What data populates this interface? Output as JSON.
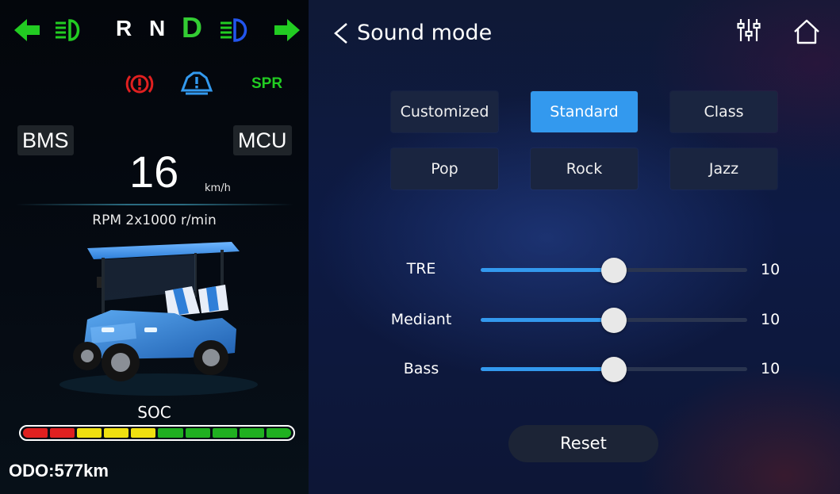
{
  "dash": {
    "gears": [
      "R",
      "N",
      "D"
    ],
    "active_gear": "D",
    "spr_label": "SPR",
    "bms_label": "BMS",
    "mcu_label": "MCU",
    "speed": "16",
    "speed_unit": "km/h",
    "rpm_text": "RPM 2x1000 r/min",
    "soc_label": "SOC",
    "soc_segments": [
      "#e02020",
      "#e02020",
      "#f0e010",
      "#f0e010",
      "#f0e010",
      "#20b020",
      "#20b020",
      "#20b020",
      "#20b020",
      "#20b020"
    ],
    "odo_text": "ODO:577km",
    "indicator_colors": {
      "turn": "#22cc22",
      "low_beam": "#22cc22",
      "high_beam": "#2255ee",
      "brake": "#e02020",
      "tire": "#3399ee"
    }
  },
  "sound": {
    "title": "Sound mode",
    "modes": [
      {
        "label": "Customized",
        "selected": false
      },
      {
        "label": "Standard",
        "selected": true
      },
      {
        "label": "Class",
        "selected": false
      },
      {
        "label": "Pop",
        "selected": false
      },
      {
        "label": "Rock",
        "selected": false
      },
      {
        "label": "Jazz",
        "selected": false
      }
    ],
    "sliders": [
      {
        "label": "TRE",
        "value": "10",
        "level": 0.5
      },
      {
        "label": "Mediant",
        "value": "10",
        "level": 0.5
      },
      {
        "label": "Bass",
        "value": "10",
        "level": 0.5
      }
    ],
    "reset_label": "Reset",
    "accent_color": "#3399ee"
  }
}
